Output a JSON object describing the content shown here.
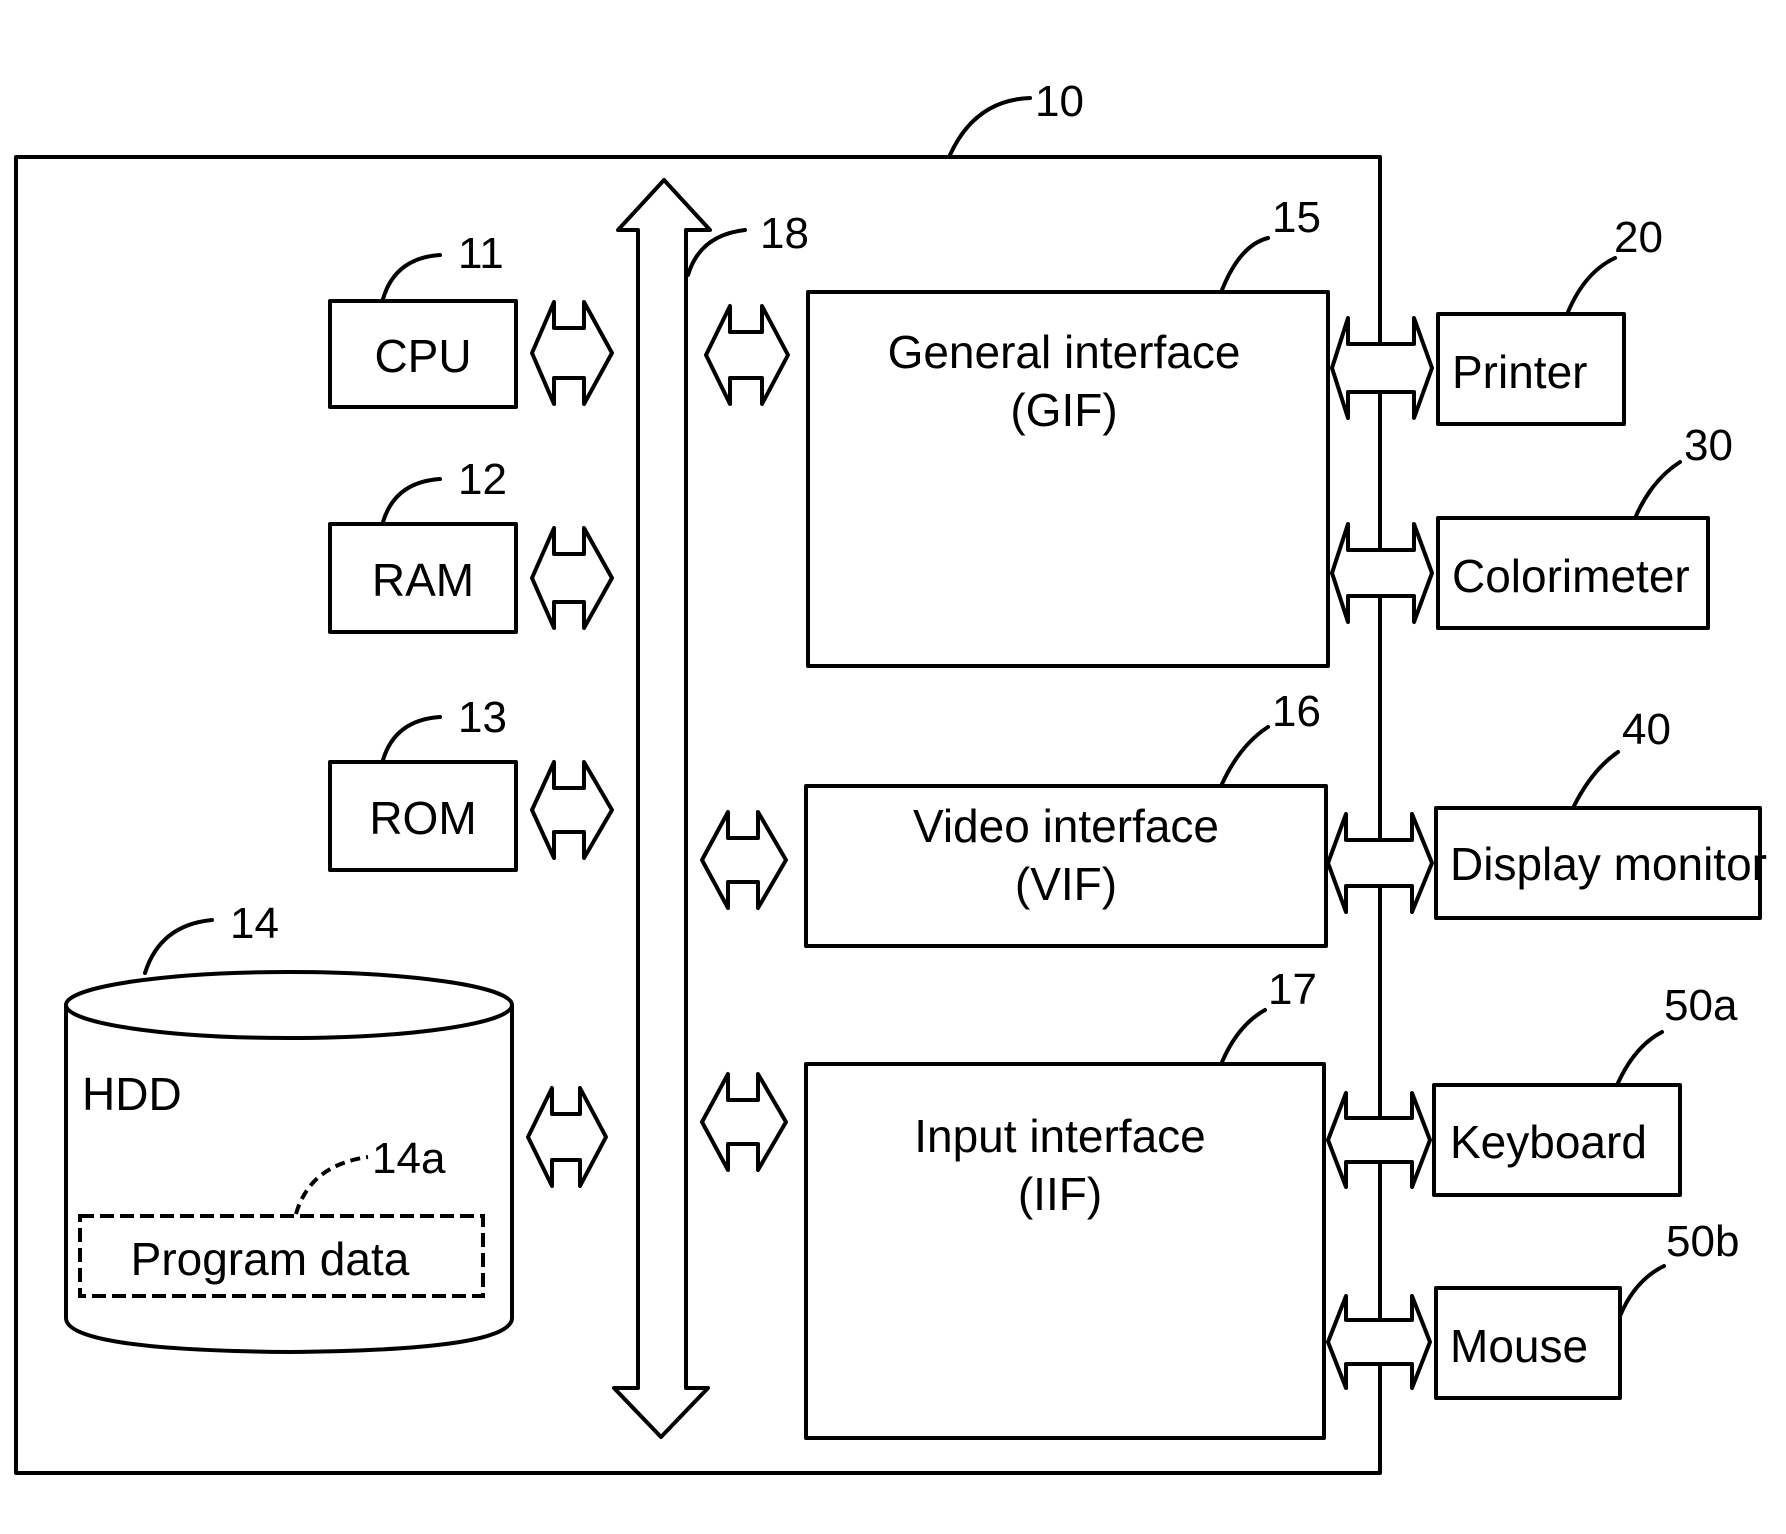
{
  "diagram": {
    "system": {
      "ref": "10"
    },
    "bus": {
      "ref": "18"
    },
    "cpu": {
      "ref": "11",
      "label": "CPU"
    },
    "ram": {
      "ref": "12",
      "label": "RAM"
    },
    "rom": {
      "ref": "13",
      "label": "ROM"
    },
    "hdd": {
      "ref": "14",
      "label": "HDD",
      "program": {
        "ref": "14a",
        "label": "Program data"
      }
    },
    "gif": {
      "ref": "15",
      "line1": "General interface",
      "line2": "(GIF)"
    },
    "vif": {
      "ref": "16",
      "line1": "Video interface",
      "line2": "(VIF)"
    },
    "iif": {
      "ref": "17",
      "line1": "Input interface",
      "line2": "(IIF)"
    },
    "printer": {
      "ref": "20",
      "label": "Printer"
    },
    "colorimeter": {
      "ref": "30",
      "label": "Colorimeter"
    },
    "display": {
      "ref": "40",
      "label": "Display monitor"
    },
    "keyboard": {
      "ref": "50a",
      "label": "Keyboard"
    },
    "mouse": {
      "ref": "50b",
      "label": "Mouse"
    }
  }
}
